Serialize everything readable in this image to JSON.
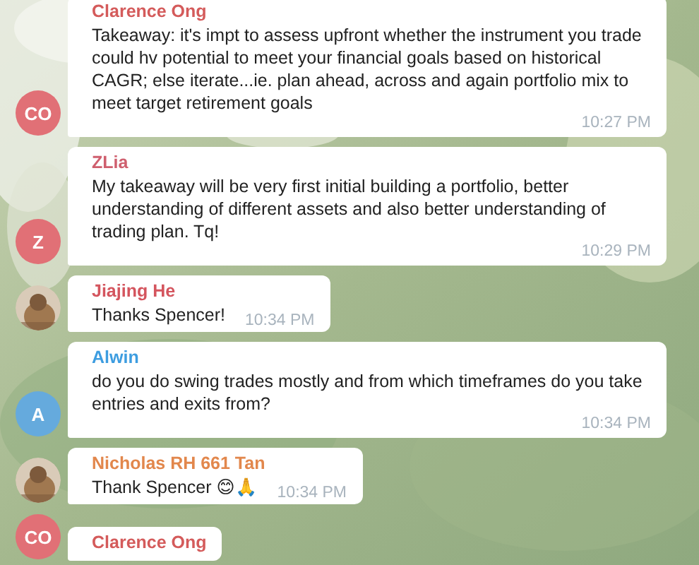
{
  "messages": [
    {
      "sender": "Clarence Ong",
      "color": "#d45b5b",
      "avatar": {
        "kind": "initials",
        "initials": "CO",
        "color": "#e17076"
      },
      "text": "Takeaway: it's impt to assess upfront whether the instrument you trade could hv potential to meet your financial goals based on historical CAGR; else iterate...ie. plan ahead, across and again portfolio mix to meet target retirement goals",
      "time": "10:27 PM"
    },
    {
      "sender": "ZLia",
      "color": "#cf5f6e",
      "avatar": {
        "kind": "initials",
        "initials": "Z",
        "color": "#e17076"
      },
      "text": "My takeaway will be very first initial building a portfolio, better understanding of different assets and also better understanding of trading plan. Tq!",
      "time": "10:29 PM"
    },
    {
      "sender": "Jiajing He",
      "color": "#d4555e",
      "text": "Thanks Spencer!",
      "time": "10:34 PM"
    },
    {
      "sender": "Alwin",
      "color": "#3d9de0",
      "avatar": {
        "kind": "initials",
        "initials": "A",
        "color": "#65aadd"
      },
      "text": "do you do swing trades mostly and from which timeframes do you take entries and exits from?",
      "time": "10:34 PM"
    },
    {
      "sender": "Nicholas RH 661 Tan",
      "color": "#e2874c",
      "text": "Thank Spencer 😊🙏",
      "time": "10:34 PM"
    },
    {
      "sender": "Clarence Ong",
      "color": "#d45b5b",
      "avatar": {
        "kind": "initials",
        "initials": "CO",
        "color": "#e17076"
      }
    }
  ]
}
